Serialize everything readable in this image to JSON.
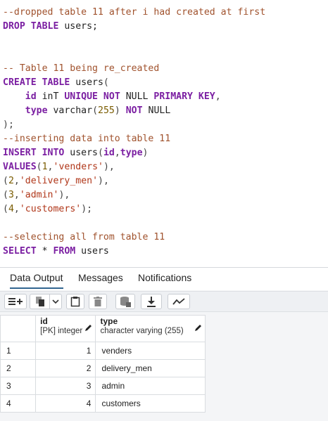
{
  "editor": {
    "lines": [
      [
        {
          "t": "--dropped table 11 after i had created at first",
          "c": "cm"
        }
      ],
      [
        {
          "t": "DROP TABLE",
          "c": "kw"
        },
        {
          "t": " users;",
          "c": "id"
        }
      ],
      [],
      [],
      [
        {
          "t": "-- Table 11 being re_created",
          "c": "cm"
        }
      ],
      [
        {
          "t": "CREATE TABLE",
          "c": "kw"
        },
        {
          "t": " users",
          "c": "id"
        },
        {
          "t": "(",
          "c": "pn"
        }
      ],
      [
        {
          "t": "    ",
          "c": "id"
        },
        {
          "t": "id",
          "c": "kw"
        },
        {
          "t": " inT ",
          "c": "id"
        },
        {
          "t": "UNIQUE NOT",
          "c": "kw"
        },
        {
          "t": " NULL ",
          "c": "id"
        },
        {
          "t": "PRIMARY KEY",
          "c": "kw"
        },
        {
          "t": ",",
          "c": "pn"
        }
      ],
      [
        {
          "t": "    ",
          "c": "id"
        },
        {
          "t": "type",
          "c": "kw"
        },
        {
          "t": " varchar",
          "c": "id"
        },
        {
          "t": "(",
          "c": "pn"
        },
        {
          "t": "255",
          "c": "num"
        },
        {
          "t": ")",
          "c": "pn"
        },
        {
          "t": " NOT",
          "c": "kw"
        },
        {
          "t": " NULL",
          "c": "id"
        }
      ],
      [
        {
          "t": ");",
          "c": "pn"
        }
      ],
      [
        {
          "t": "--inserting data into table 11",
          "c": "cm"
        }
      ],
      [
        {
          "t": "INSERT INTO",
          "c": "kw"
        },
        {
          "t": " users",
          "c": "id"
        },
        {
          "t": "(",
          "c": "pn"
        },
        {
          "t": "id",
          "c": "kw"
        },
        {
          "t": ",",
          "c": "pn"
        },
        {
          "t": "type",
          "c": "kw"
        },
        {
          "t": ")",
          "c": "pn"
        }
      ],
      [
        {
          "t": "VALUES",
          "c": "kw"
        },
        {
          "t": "(",
          "c": "pn"
        },
        {
          "t": "1",
          "c": "num"
        },
        {
          "t": ",",
          "c": "pn"
        },
        {
          "t": "'venders'",
          "c": "str"
        },
        {
          "t": "),",
          "c": "pn"
        }
      ],
      [
        {
          "t": "(",
          "c": "pn"
        },
        {
          "t": "2",
          "c": "num"
        },
        {
          "t": ",",
          "c": "pn"
        },
        {
          "t": "'delivery_men'",
          "c": "str"
        },
        {
          "t": "),",
          "c": "pn"
        }
      ],
      [
        {
          "t": "(",
          "c": "pn"
        },
        {
          "t": "3",
          "c": "num"
        },
        {
          "t": ",",
          "c": "pn"
        },
        {
          "t": "'admin'",
          "c": "str"
        },
        {
          "t": "),",
          "c": "pn"
        }
      ],
      [
        {
          "t": "(",
          "c": "pn"
        },
        {
          "t": "4",
          "c": "num"
        },
        {
          "t": ",",
          "c": "pn"
        },
        {
          "t": "'customers'",
          "c": "str"
        },
        {
          "t": ");",
          "c": "pn"
        }
      ],
      [],
      [
        {
          "t": "--selecting all from table 11",
          "c": "cm"
        }
      ],
      [
        {
          "t": "SELECT",
          "c": "kw"
        },
        {
          "t": " * ",
          "c": "id"
        },
        {
          "t": "FROM",
          "c": "kw"
        },
        {
          "t": " users",
          "c": "id"
        }
      ]
    ]
  },
  "tabs": [
    {
      "label": "Data Output",
      "active": true
    },
    {
      "label": "Messages",
      "active": false
    },
    {
      "label": "Notifications",
      "active": false
    }
  ],
  "toolbar": {
    "buttons": [
      "add-row-icon",
      "copy-icon",
      "chevron-down-icon",
      "paste-icon",
      "delete-icon",
      "save-data-icon",
      "download-icon",
      "graph-visualiser-icon"
    ]
  },
  "grid": {
    "columns": [
      {
        "name": "id",
        "type": "[PK] integer"
      },
      {
        "name": "type",
        "type": "character varying (255)"
      }
    ],
    "rows": [
      {
        "num": "1",
        "id": "1",
        "type": "venders"
      },
      {
        "num": "2",
        "id": "2",
        "type": "delivery_men"
      },
      {
        "num": "3",
        "id": "3",
        "type": "admin"
      },
      {
        "num": "4",
        "id": "4",
        "type": "customers"
      }
    ]
  },
  "colors": {
    "comment": "#a0522d",
    "keyword": "#7b1fa2",
    "string": "#b0371a",
    "number": "#7a5c00",
    "active_tab": "#326690"
  }
}
